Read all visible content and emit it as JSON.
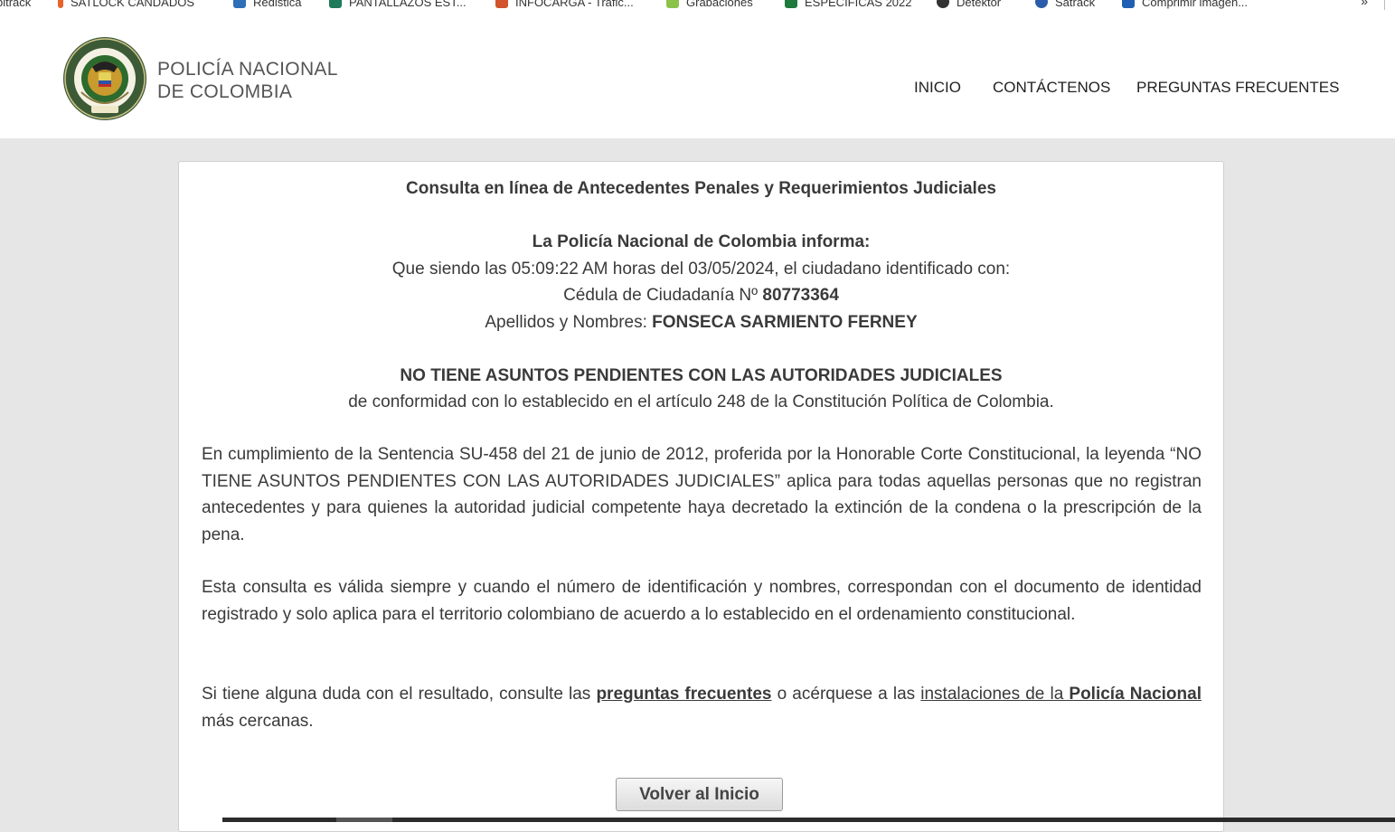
{
  "bookmarks": {
    "items": [
      {
        "label": "bitrack",
        "color": "#888888"
      },
      {
        "label": "SATLOCK CANDADOS",
        "color": "#e8622a"
      },
      {
        "label": "Redistica",
        "color": "#2f6fb8"
      },
      {
        "label": "PANTALLAZOS EST...",
        "color": "#1f7a5a"
      },
      {
        "label": "INFOCARGA - Trafic...",
        "color": "#d2532c"
      },
      {
        "label": "Grabaciones",
        "color": "#8bc34a"
      },
      {
        "label": "ESPECIFICAS 2022",
        "color": "#1d7a3c"
      },
      {
        "label": "Detektor",
        "color": "#333333"
      },
      {
        "label": "Satrack",
        "color": "#2a5caa"
      },
      {
        "label": "Comprimir imagen...",
        "color": "#1e5fb4"
      }
    ],
    "more": "»"
  },
  "header": {
    "brand_line1": "POLICÍA NACIONAL",
    "brand_line2": "DE COLOMBIA",
    "logo_text_top": "REPÚBLICA DE COLOMBIA",
    "logo_text_bottom": "POLICÍA NACIONAL",
    "logo_motto": "DIOS Y PATRIA",
    "nav": [
      "INICIO",
      "CONTÁCTENOS",
      "PREGUNTAS FRECUENTES"
    ]
  },
  "result": {
    "title": "Consulta en línea de Antecedentes Penales y Requerimientos Judiciales",
    "informa": "La Policía Nacional de Colombia informa:",
    "line1": "Que siendo las 05:09:22 AM horas del 03/05/2024, el ciudadano identificado con:",
    "id_label": "Cédula de Ciudadanía Nº ",
    "id_number": "80773364",
    "name_label": "Apellidos y Nombres: ",
    "name_value": "FONSECA SARMIENTO FERNEY",
    "status": "NO TIENE ASUNTOS PENDIENTES CON LAS AUTORIDADES JUDICIALES",
    "status_sub": "de conformidad con lo establecido en el artículo 248 de la Constitución Política de Colombia.",
    "para1": "En cumplimiento de la Sentencia SU-458 del 21 de junio de 2012, proferida por la Honorable Corte Constitucional, la leyenda “NO TIENE ASUNTOS PENDIENTES CON LAS AUTORIDADES JUDICIALES” aplica para todas aquellas personas que no registran antecedentes y para quienes la autoridad judicial competente haya decretado la extinción de la condena o la prescripción de la pena.",
    "para2": "Esta consulta es válida siempre y cuando el número de identificación y nombres, correspondan con el documento de identidad registrado y solo aplica para el territorio colombiano de acuerdo a lo establecido en el ordenamiento constitucional.",
    "para3_a": "Si tiene alguna duda con el resultado, consulte las ",
    "para3_link1": "preguntas frecuentes",
    "para3_b": " o acérquese a las ",
    "para3_link2_a": "instalaciones de la ",
    "para3_link2_b": "Policía Nacional",
    "para3_c": " más cercanas.",
    "button": "Volver al Inicio"
  }
}
